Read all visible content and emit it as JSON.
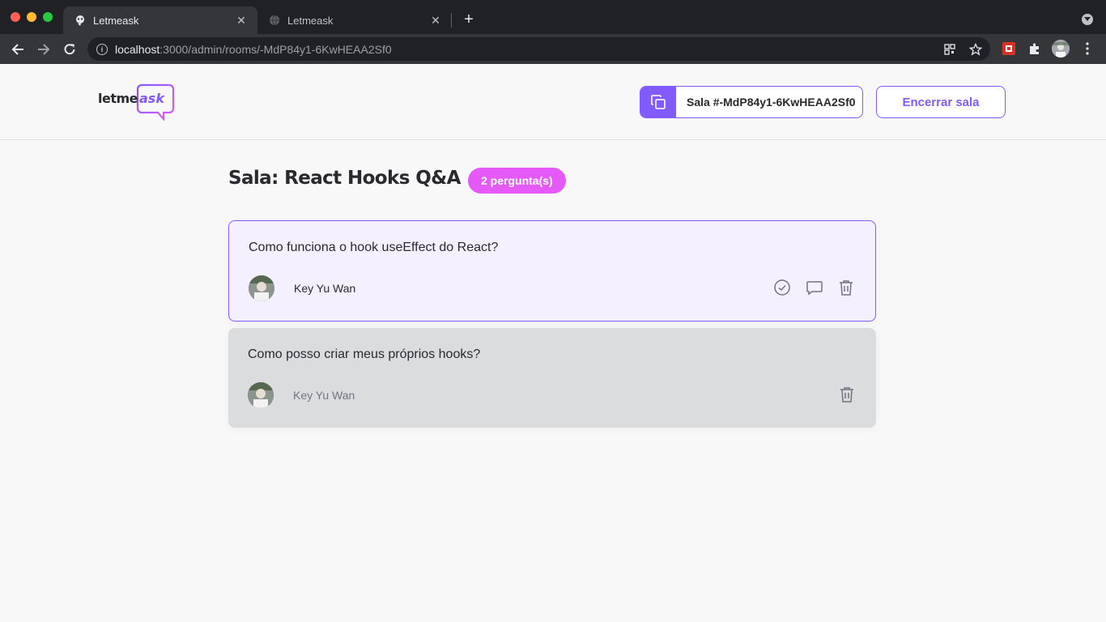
{
  "browser": {
    "tabs": [
      {
        "title": "Letmeask",
        "active": true
      },
      {
        "title": "Letmeask",
        "active": false
      }
    ],
    "url_host": "localhost",
    "url_rest": ":3000/admin/rooms/-MdP84y1-6KwHEAA2Sf0"
  },
  "header": {
    "logo_text_1": "letme",
    "logo_text_2": "ask",
    "room_code_label": "Sala #-MdP84y1-6KwHEAA2Sf0",
    "close_room_label": "Encerrar sala"
  },
  "room": {
    "title": "Sala: React Hooks Q&A",
    "question_count": "2 pergunta(s)"
  },
  "questions": [
    {
      "content": "Como funciona o hook useEffect do React?",
      "author": "Key Yu Wan",
      "state": "highlighted"
    },
    {
      "content": "Como posso criar meus próprios hooks?",
      "author": "Key Yu Wan",
      "state": "answered"
    }
  ],
  "colors": {
    "accent": "#835afd",
    "badge": "#e559f9",
    "highlight_bg": "#f4f0ff",
    "answered_bg": "#dbdcdd"
  }
}
